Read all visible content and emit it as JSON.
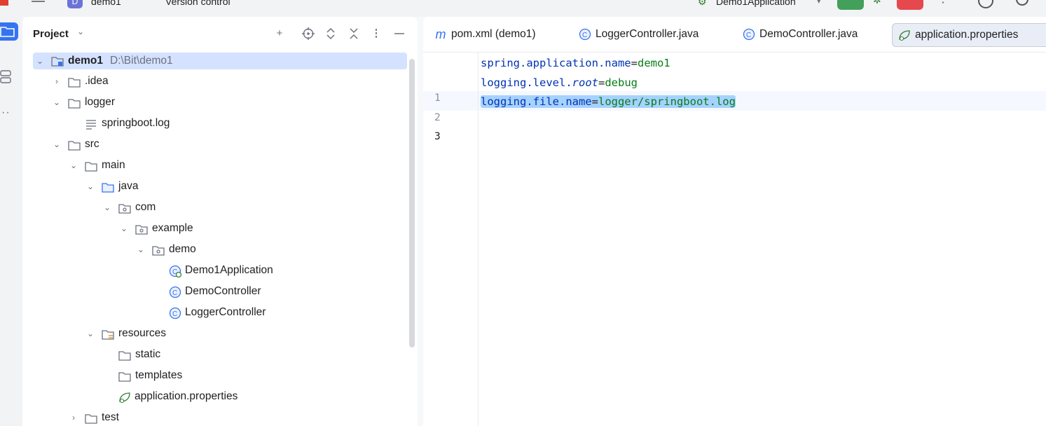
{
  "topbar": {
    "project_badge": "D",
    "project_name": "demo1",
    "vcs": "Version control",
    "run_config": "Demo1Application"
  },
  "project_panel": {
    "title": "Project",
    "tree": [
      {
        "label": "demo1",
        "hint": "D:\\Bit\\demo1",
        "icon": "module-folder-icon",
        "arrow": "down"
      },
      {
        "label": ".idea",
        "icon": "folder-icon",
        "arrow": "right"
      },
      {
        "label": "logger",
        "icon": "folder-icon",
        "arrow": "down"
      },
      {
        "label": "springboot.log",
        "icon": "text-file-icon",
        "arrow": ""
      },
      {
        "label": "src",
        "icon": "folder-icon",
        "arrow": "down"
      },
      {
        "label": "main",
        "icon": "folder-icon",
        "arrow": "down"
      },
      {
        "label": "java",
        "icon": "source-folder-icon",
        "arrow": "down"
      },
      {
        "label": "com",
        "icon": "package-icon",
        "arrow": "down"
      },
      {
        "label": "example",
        "icon": "package-icon",
        "arrow": "down"
      },
      {
        "label": "demo",
        "icon": "package-icon",
        "arrow": "down"
      },
      {
        "label": "Demo1Application",
        "icon": "spring-boot-class-icon",
        "arrow": ""
      },
      {
        "label": "DemoController",
        "icon": "class-icon",
        "arrow": ""
      },
      {
        "label": "LoggerController",
        "icon": "class-icon",
        "arrow": ""
      },
      {
        "label": "resources",
        "icon": "resources-folder-icon",
        "arrow": "down"
      },
      {
        "label": "static",
        "icon": "folder-icon",
        "arrow": ""
      },
      {
        "label": "templates",
        "icon": "folder-icon",
        "arrow": ""
      },
      {
        "label": "application.properties",
        "icon": "spring-properties-icon",
        "arrow": ""
      },
      {
        "label": "test",
        "icon": "folder-icon",
        "arrow": "right"
      }
    ]
  },
  "editor": {
    "tabs": [
      {
        "label": "pom.xml (demo1)",
        "icon": "maven-icon"
      },
      {
        "label": "LoggerController.java",
        "icon": "class-icon"
      },
      {
        "label": "DemoController.java",
        "icon": "class-icon"
      },
      {
        "label": "application.properties",
        "icon": "spring-properties-icon"
      }
    ],
    "lines": [
      {
        "num": "1",
        "key1": "spring.application.name",
        "eq": "=",
        "value": "demo1"
      },
      {
        "num": "2",
        "key1": "logging.level.",
        "key2": "root",
        "eq": "=",
        "value": "debug"
      },
      {
        "num": "3",
        "key1": "logging.file.name",
        "eq": "=",
        "value": "logger/springboot.log"
      }
    ]
  },
  "colors": {
    "selection": "#d4e2ff",
    "accent": "#3574f0",
    "key": "#0033b3",
    "value": "#067d17"
  }
}
